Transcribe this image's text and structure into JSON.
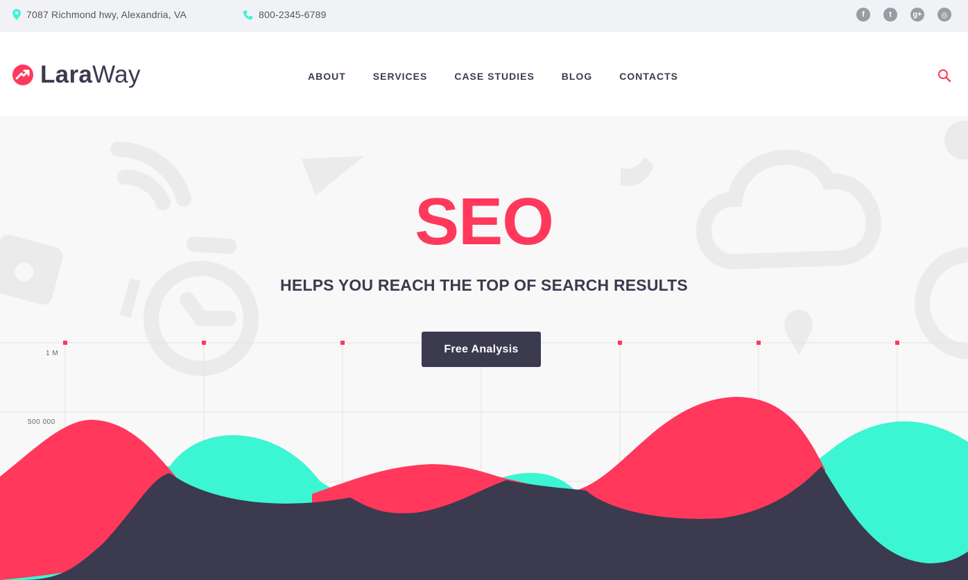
{
  "topbar": {
    "address": "7087 Richmond hwy, Alexandria, VA",
    "phone": "800-2345-6789",
    "social": [
      {
        "icon": "facebook-icon",
        "glyph": "f"
      },
      {
        "icon": "twitter-icon",
        "glyph": "t"
      },
      {
        "icon": "google-plus-icon",
        "glyph": "g+"
      },
      {
        "icon": "instagram-icon",
        "glyph": "◎"
      }
    ]
  },
  "header": {
    "logo_bold": "Lara",
    "logo_light": "Way",
    "nav": [
      "ABOUT",
      "SERVICES",
      "CASE STUDIES",
      "BLOG",
      "CONTACTS"
    ]
  },
  "hero": {
    "headline": "SEO",
    "subline": "HELPS YOU REACH THE TOP OF SEARCH RESULTS",
    "cta": "Free Analysis",
    "y_labels": [
      "1 M",
      "500 000"
    ]
  },
  "colors": {
    "accent": "#ff385c",
    "teal": "#3cf5d3",
    "dark": "#3b3a4f"
  }
}
